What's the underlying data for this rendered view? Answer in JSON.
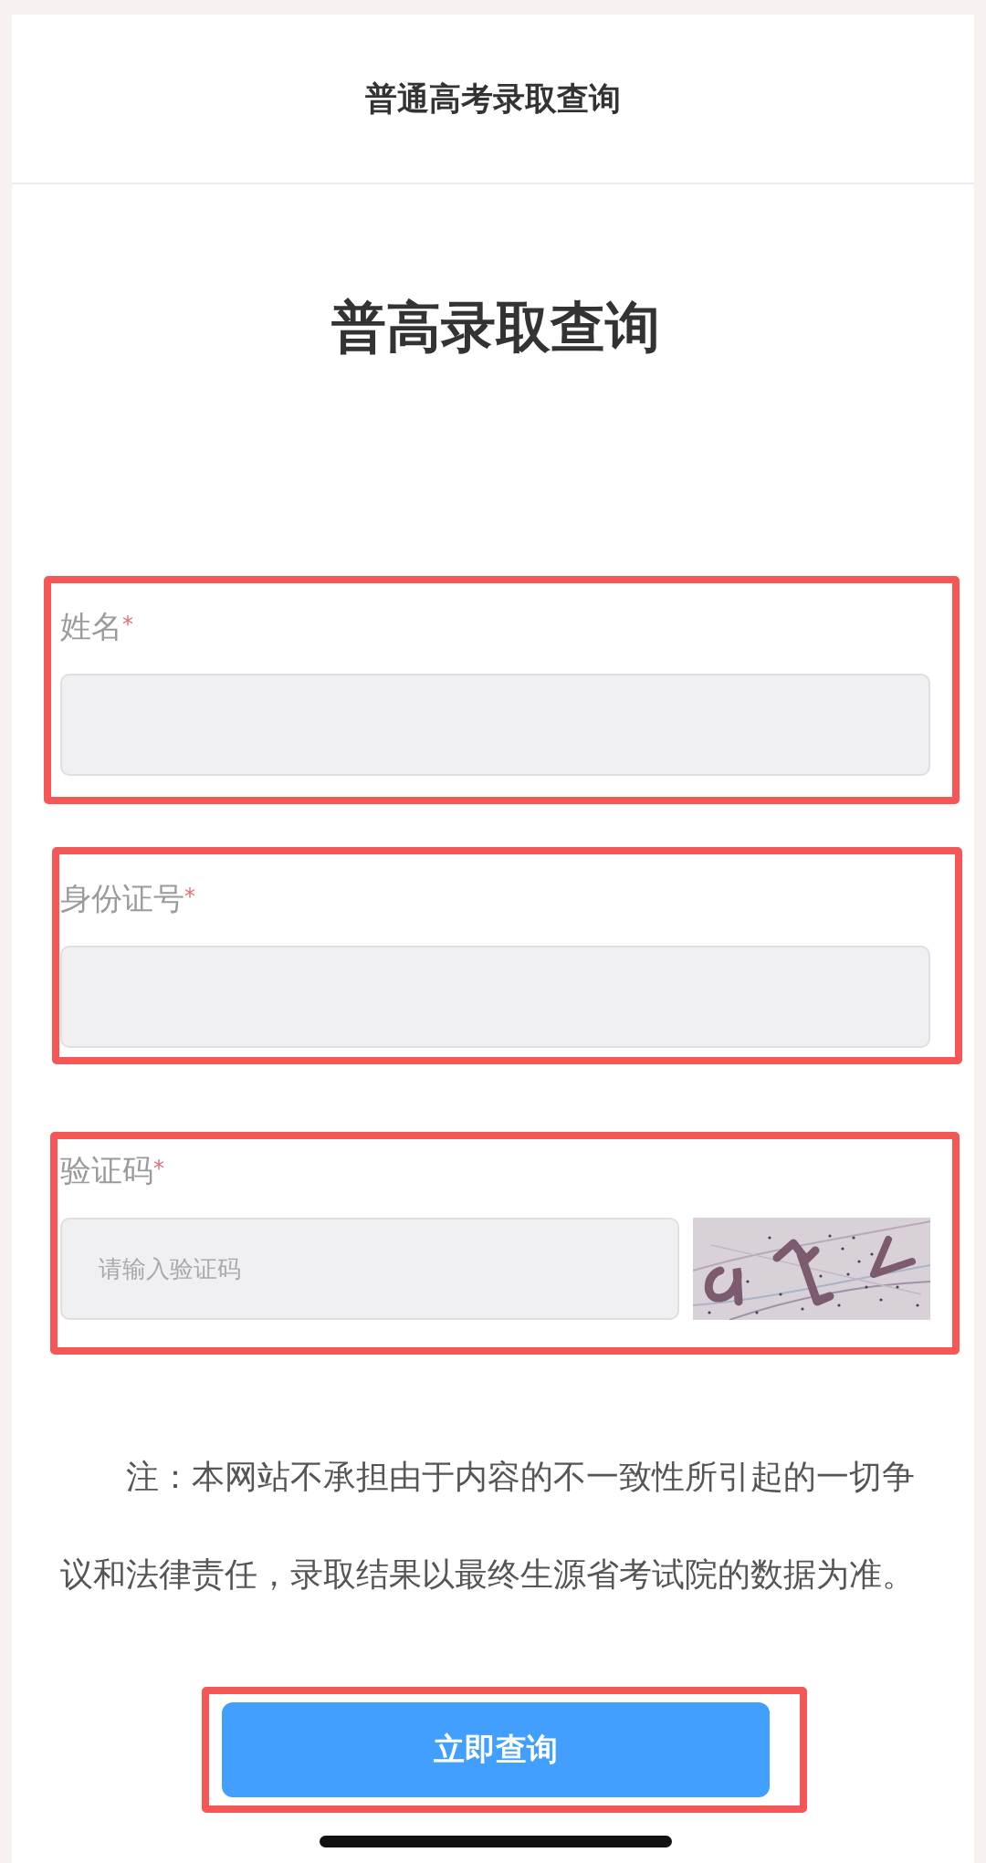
{
  "header": {
    "title": "普通高考录取查询"
  },
  "heading": "普高录取查询",
  "fields": [
    {
      "kind": "text",
      "label": "姓名",
      "required_mark": "*",
      "highlighted": true
    },
    {
      "kind": "text",
      "label": "身份证号",
      "required_mark": "*",
      "highlighted": true
    },
    {
      "kind": "captcha",
      "label": "验证码",
      "required_mark": "*",
      "placeholder": "请输入验证码",
      "highlighted": true
    }
  ],
  "note": "注：本网站不承担由于内容的不一致性所引起的一切争议和法律责任，录取结果以最终生源省考试院的数据为准。",
  "submit_button": {
    "label": "立即查询",
    "highlighted": true
  }
}
